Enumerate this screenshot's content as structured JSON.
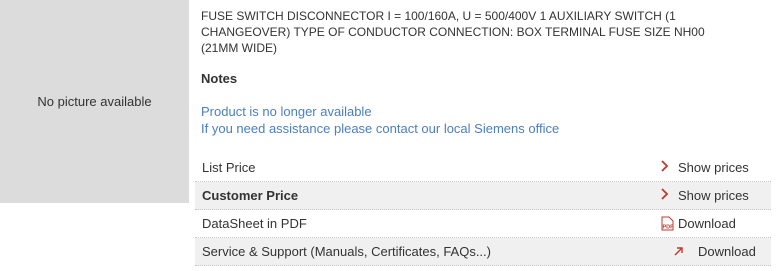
{
  "image": {
    "placeholder_text": "No picture available"
  },
  "product": {
    "description_lines": [
      "FUSE SWITCH DISCONNECTOR I = 100/160A, U = 500/400V 1 AUXILIARY SWITCH (1",
      "CHANGEOVER) TYPE OF CONDUCTOR CONNECTION: BOX TERMINAL FUSE SIZE NH00",
      "(21MM WIDE)"
    ]
  },
  "notes": {
    "title": "Notes",
    "lines": [
      "Product is no longer available",
      "If you need assistance please contact our local Siemens office"
    ]
  },
  "rows": [
    {
      "label": "List Price",
      "action": "Show prices",
      "icon": "chevron-right-icon"
    },
    {
      "label": "Customer Price",
      "action": "Show prices",
      "icon": "chevron-right-icon"
    },
    {
      "label": "DataSheet in PDF",
      "action": "Download",
      "icon": "pdf-icon"
    },
    {
      "label": "Service & Support (Manuals, Certificates, FAQs...)",
      "action": "Download",
      "icon": "external-link-icon"
    }
  ],
  "colors": {
    "accent": "#c0392b",
    "link": "#4a7fc1",
    "placeholder_bg": "#dcdcdc"
  }
}
